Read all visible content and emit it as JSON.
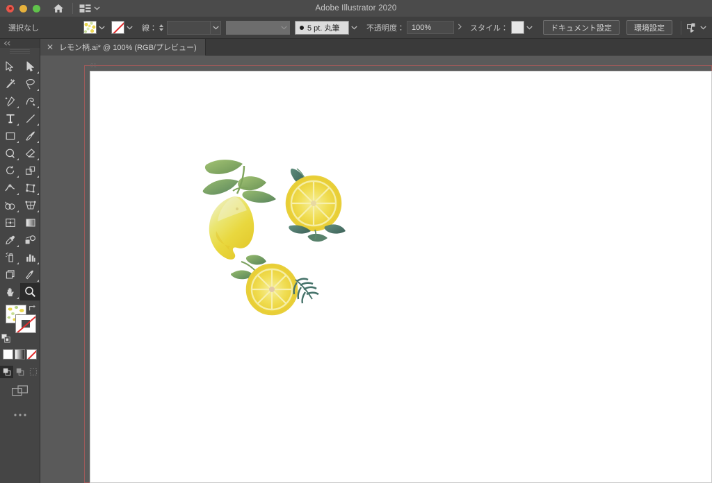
{
  "app": {
    "title": "Adobe Illustrator 2020"
  },
  "titlebar": {
    "window_controls": [
      "close",
      "minimize",
      "maximize"
    ],
    "home_icon": "home-icon",
    "arrange_documents_icon": "arrange-documents-icon",
    "arrange_chevron_icon": "chevron-down-icon"
  },
  "controlbar": {
    "selection_status": "選択なし",
    "fill_swatch_name": "fill-swatch",
    "fill_chevron_icon": "chevron-down-icon",
    "stroke_swatch_name": "stroke-swatch-none",
    "stroke_chevron_icon": "chevron-down-icon",
    "stroke_label": "線：",
    "stroke_weight_value": "",
    "stroke_weight_chevron_icon": "chevron-down-icon",
    "variable_width_value": "",
    "variable_width_chevron_icon": "chevron-down-icon",
    "brush_value": "5 pt. 丸筆",
    "brush_chevron_icon": "chevron-down-icon",
    "opacity_label": "不透明度：",
    "opacity_value": "100%",
    "opacity_flyout_icon": "chevron-right-icon",
    "style_label": "スタイル：",
    "style_swatch_name": "graphic-style-swatch",
    "style_chevron_icon": "chevron-down-icon",
    "document_setup_button": "ドキュメント設定",
    "preferences_button": "環境設定",
    "align_icon": "align-objects-icon",
    "align_chevron_icon": "chevron-down-icon"
  },
  "tabbar": {
    "tabs": [
      {
        "close_icon": "close-icon",
        "title": "レモン柄.ai* @ 100% (RGB/プレビュー)"
      }
    ]
  },
  "toolpanel": {
    "collapse_icon": "double-chevron-left-icon",
    "tools": [
      {
        "name": "selection-tool",
        "has_flyout": false
      },
      {
        "name": "direct-selection-tool",
        "has_flyout": true
      },
      {
        "name": "magic-wand-tool",
        "has_flyout": false
      },
      {
        "name": "lasso-tool",
        "has_flyout": false
      },
      {
        "name": "pen-tool",
        "has_flyout": true
      },
      {
        "name": "curvature-tool",
        "has_flyout": false
      },
      {
        "name": "type-tool",
        "has_flyout": true
      },
      {
        "name": "line-segment-tool",
        "has_flyout": true
      },
      {
        "name": "rectangle-tool",
        "has_flyout": true
      },
      {
        "name": "paintbrush-tool",
        "has_flyout": true
      },
      {
        "name": "shaper-tool",
        "has_flyout": true
      },
      {
        "name": "eraser-tool",
        "has_flyout": true
      },
      {
        "name": "rotate-tool",
        "has_flyout": true
      },
      {
        "name": "scale-tool",
        "has_flyout": true
      },
      {
        "name": "width-tool",
        "has_flyout": true
      },
      {
        "name": "free-transform-tool",
        "has_flyout": false
      },
      {
        "name": "shape-builder-tool",
        "has_flyout": true
      },
      {
        "name": "perspective-grid-tool",
        "has_flyout": true
      },
      {
        "name": "mesh-tool",
        "has_flyout": false
      },
      {
        "name": "gradient-tool",
        "has_flyout": false
      },
      {
        "name": "eyedropper-tool",
        "has_flyout": true
      },
      {
        "name": "blend-tool",
        "has_flyout": false
      },
      {
        "name": "symbol-sprayer-tool",
        "has_flyout": true
      },
      {
        "name": "column-graph-tool",
        "has_flyout": true
      },
      {
        "name": "artboard-tool",
        "has_flyout": false
      },
      {
        "name": "slice-tool",
        "has_flyout": true
      },
      {
        "name": "hand-tool",
        "has_flyout": true
      },
      {
        "name": "zoom-tool",
        "has_flyout": false
      }
    ],
    "active_tool": "zoom-tool",
    "fill_proxy_name": "fill-color-proxy",
    "stroke_proxy_name": "stroke-color-proxy",
    "swap_icon": "swap-fill-stroke-icon",
    "default_icon": "default-fill-stroke-icon",
    "color_modes": [
      {
        "name": "color-mode-solid",
        "active": true
      },
      {
        "name": "color-mode-gradient",
        "active": false
      },
      {
        "name": "color-mode-none",
        "active": false
      }
    ],
    "draw_modes": [
      {
        "name": "draw-normal-mode",
        "active": true
      },
      {
        "name": "draw-behind-mode",
        "active": false
      },
      {
        "name": "draw-inside-mode",
        "active": false
      }
    ],
    "screen_mode_icon": "change-screen-mode-icon",
    "edit_toolbar_icon": "edit-toolbar-ellipsis"
  },
  "canvas": {
    "artboard_label": "01",
    "zoom_level": "100%",
    "color_mode": "RGB",
    "view_mode": "プレビュー",
    "artwork_name": "watercolor-lemons-illustration"
  },
  "colors": {
    "titlebar_bg": "#4b4b4b",
    "controlbar_bg": "#3f3f3f",
    "tabbar_bg": "#3a3a3a",
    "active_tab_bg": "#4b4b4b",
    "toolpanel_bg": "#454545",
    "canvas_bg": "#5a5a5a",
    "artboard_bg": "#ffffff",
    "bleed_guide": "#9e5a5a",
    "text_primary": "#d0d0d0",
    "lemon_yellow": "#ead84e",
    "lemon_yellow_deep": "#e5c62f",
    "leaf_green": "#7fa85a",
    "leaf_green_dark": "#4f7a52",
    "leaf_teal": "#3f6b63",
    "accent_red": "#e02b2b"
  }
}
